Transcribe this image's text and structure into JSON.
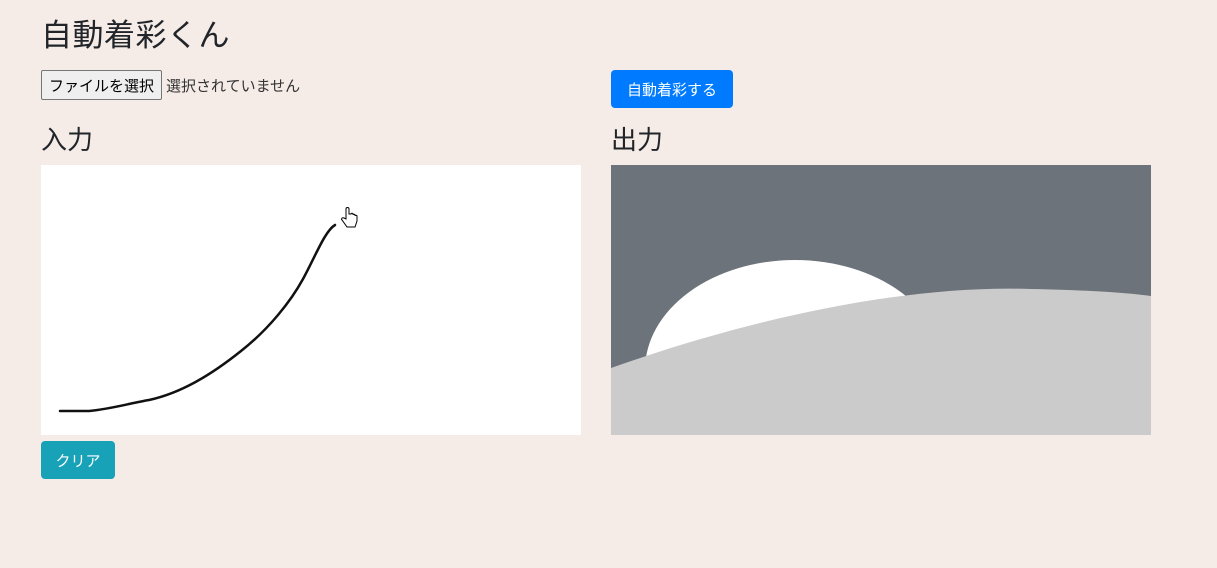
{
  "app": {
    "title": "自動着彩くん"
  },
  "file_input": {
    "button_label": "ファイルを選択",
    "status_text": "選択されていません"
  },
  "actions": {
    "colorize_label": "自動着彩する",
    "clear_label": "クリア"
  },
  "input_panel": {
    "heading": "入力",
    "stroke_color": "#111111"
  },
  "output_panel": {
    "heading": "出力",
    "colors": {
      "background": "#6c737a",
      "circle": "#ffffff",
      "hill": "#cbcbcb"
    }
  },
  "colors": {
    "page_background": "#f5ebe7",
    "primary": "#007bff",
    "info": "#17a2b8"
  },
  "cursor": {
    "icon": "hand-pointer-icon"
  }
}
